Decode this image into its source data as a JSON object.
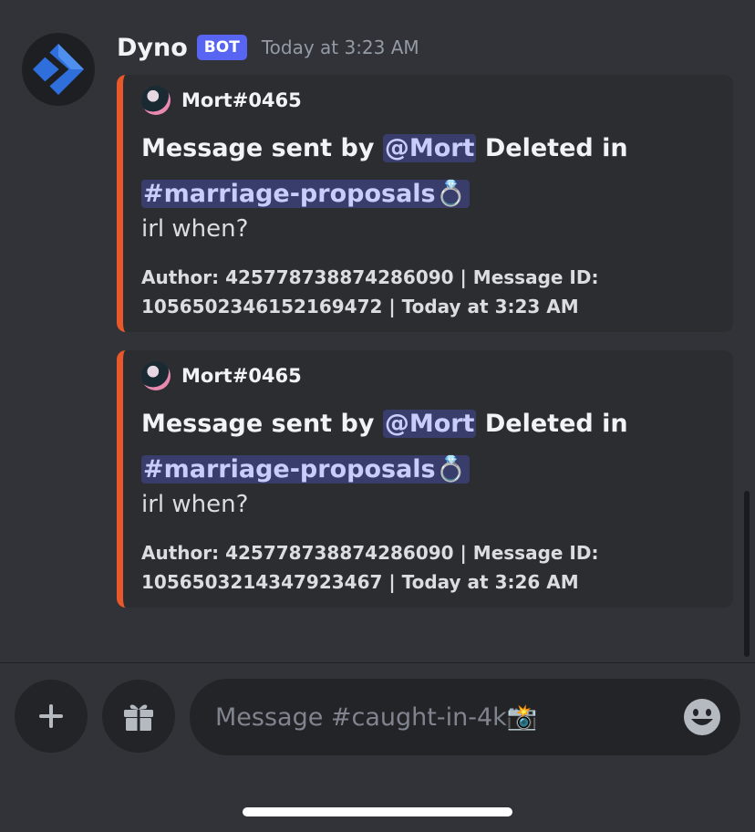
{
  "message": {
    "username": "Dyno",
    "badge": "BOT",
    "timestamp": "Today at 3:23 AM"
  },
  "embeds": [
    {
      "author": "Mort#0465",
      "title_prefix": "Message sent by ",
      "mention": "@Mort",
      "title_middle": " Deleted in ",
      "channel": "#marriage-proposals💍",
      "description": "irl when?",
      "footer_line1": "Author: 425778738874286090 | Message ID:",
      "footer_line2": "1056502346152169472 | Today at 3:23 AM"
    },
    {
      "author": "Mort#0465",
      "title_prefix": "Message sent by ",
      "mention": "@Mort",
      "title_middle": " Deleted in ",
      "channel": "#marriage-proposals💍",
      "description": "irl when?",
      "footer_line1": "Author: 425778738874286090 | Message ID:",
      "footer_line2": "1056503214347923467 | Today at 3:26 AM"
    }
  ],
  "composer": {
    "placeholder": "Message #caught-in-4k📸"
  },
  "colors": {
    "background": "#313338",
    "embed_background": "#2b2d31",
    "embed_accent": "#e8582a",
    "bot_badge": "#5865f2",
    "mention": "#c9cdfb"
  }
}
